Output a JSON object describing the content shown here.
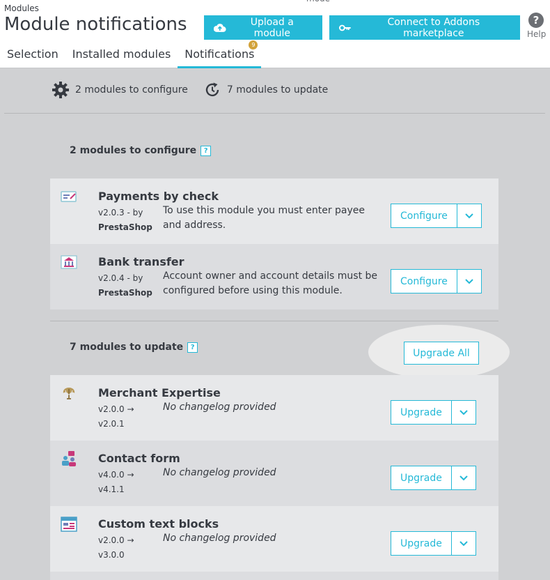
{
  "header": {
    "breadcrumb": "Modules",
    "mode_fragment": "mode",
    "title": "Module notifications",
    "upload_label": "Upload a module",
    "connect_label": "Connect to Addons marketplace",
    "help_label": "Help",
    "help_glyph": "?"
  },
  "tabs": [
    {
      "label": "Selection"
    },
    {
      "label": "Installed modules"
    },
    {
      "label": "Notifications",
      "badge": "9"
    }
  ],
  "summary": {
    "configure": "2 modules to configure",
    "update": "7 modules to update"
  },
  "configure_section": {
    "title": "2 modules to configure",
    "help": "?",
    "modules": [
      {
        "name": "Payments by check",
        "version": "v2.0.3 - by",
        "author": "PrestaShop",
        "description": "To use this module you must enter payee and address.",
        "action": "Configure"
      },
      {
        "name": "Bank transfer",
        "version": "v2.0.4 - by",
        "author": "PrestaShop",
        "description": "Account owner and account details must be configured before using this module.",
        "action": "Configure"
      }
    ]
  },
  "update_section": {
    "title": "7 modules to update",
    "help": "?",
    "upgrade_all_label": "Upgrade All",
    "modules": [
      {
        "name": "Merchant Expertise",
        "from": "v2.0.0 →",
        "to": "v2.0.1",
        "description": "No changelog provided",
        "action": "Upgrade"
      },
      {
        "name": "Contact form",
        "from": "v4.0.0 →",
        "to": "v4.1.1",
        "description": "No changelog provided",
        "action": "Upgrade"
      },
      {
        "name": "Custom text blocks",
        "from": "v2.0.0 →",
        "to": "v3.0.0",
        "description": "No changelog provided",
        "action": "Upgrade"
      }
    ]
  },
  "colors": {
    "accent": "#25b9d7",
    "badge": "#d2a23a",
    "text": "#363a41"
  },
  "icons": [
    "cloud-upload-icon",
    "key-icon",
    "help-icon",
    "gear-icon",
    "refresh-clock-icon",
    "check-payment-icon",
    "bank-icon",
    "merchant-expertise-icon",
    "contact-form-icon",
    "custom-text-icon",
    "chevron-down-icon"
  ]
}
